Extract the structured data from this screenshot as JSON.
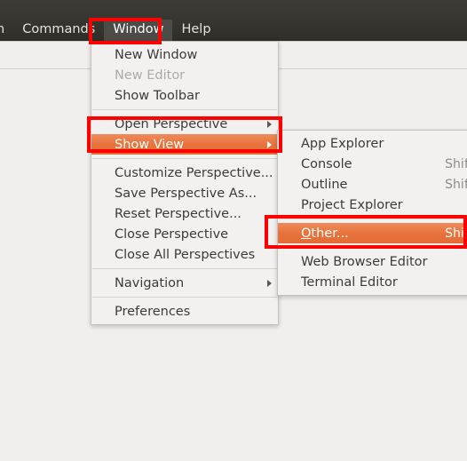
{
  "menubar": {
    "items": [
      {
        "label": "n",
        "state": "clipped"
      },
      {
        "label": "Commands",
        "state": "normal"
      },
      {
        "label": "Window",
        "state": "active"
      },
      {
        "label": "Help",
        "state": "normal"
      }
    ]
  },
  "window_menu": {
    "items": [
      {
        "label": "New Window",
        "accel": "",
        "state": "normal",
        "submenu": false
      },
      {
        "label": "New Editor",
        "accel": "",
        "state": "disabled",
        "submenu": false
      },
      {
        "label": "Show Toolbar",
        "accel": "",
        "state": "normal",
        "submenu": false
      },
      {
        "label": "Open Perspective",
        "accel": "",
        "state": "normal",
        "submenu": true
      },
      {
        "label": "Show View",
        "accel": "",
        "state": "selected",
        "submenu": true
      },
      {
        "label": "Customize Perspective...",
        "accel": "",
        "state": "normal",
        "submenu": false
      },
      {
        "label": "Save Perspective As...",
        "accel": "",
        "state": "normal",
        "submenu": false
      },
      {
        "label": "Reset Perspective...",
        "accel": "",
        "state": "normal",
        "submenu": false
      },
      {
        "label": "Close Perspective",
        "accel": "",
        "state": "normal",
        "submenu": false
      },
      {
        "label": "Close All Perspectives",
        "accel": "",
        "state": "normal",
        "submenu": false
      },
      {
        "label": "Navigation",
        "accel": "",
        "state": "normal",
        "submenu": true
      },
      {
        "label": "Preferences",
        "accel": "",
        "state": "normal",
        "submenu": false
      }
    ]
  },
  "showview_submenu": {
    "items": [
      {
        "label": "App Explorer",
        "accel": "",
        "state": "normal",
        "mnemonic": ""
      },
      {
        "label": "Console",
        "accel": "Shift",
        "state": "normal",
        "mnemonic": ""
      },
      {
        "label": "Outline",
        "accel": "Shift",
        "state": "normal",
        "mnemonic": ""
      },
      {
        "label": "Project Explorer",
        "accel": "",
        "state": "normal",
        "mnemonic": ""
      },
      {
        "label": "Other...",
        "accel": "Shift",
        "state": "selected",
        "mnemonic": "O"
      },
      {
        "label": "Web Browser Editor",
        "accel": "",
        "state": "normal",
        "mnemonic": ""
      },
      {
        "label": "Terminal Editor",
        "accel": "",
        "state": "normal",
        "mnemonic": ""
      }
    ]
  },
  "annotations": {
    "color": "#ff0000",
    "boxes": [
      {
        "name": "window-menubar-highlight"
      },
      {
        "name": "show-view-item-highlight"
      },
      {
        "name": "other-item-highlight"
      }
    ]
  },
  "colors": {
    "menubar_background": "#36352f",
    "menubar_active": "#4c4b47",
    "menu_background": "#f2f1ef",
    "selection_orange": "#e8733c",
    "app_background": "#f0efee",
    "text": "#3c3b37",
    "text_disabled": "#adaba7",
    "accel_text": "#8e8c88",
    "annotation_red": "#ff0000"
  }
}
